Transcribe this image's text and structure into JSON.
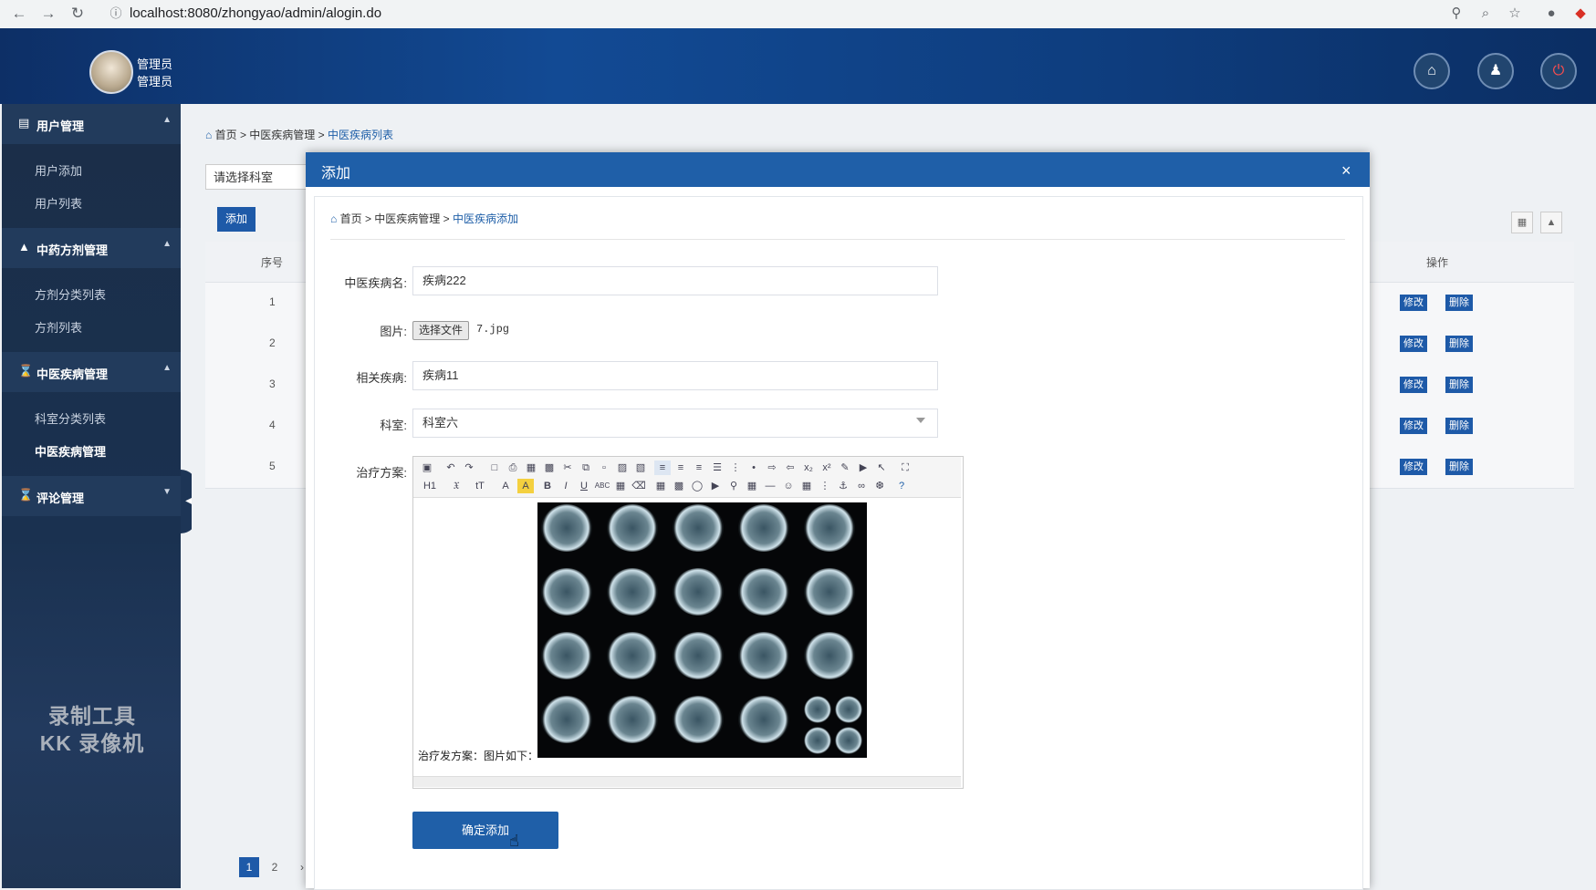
{
  "browser": {
    "url": "localhost:8080/zhongyao/admin/alogin.do",
    "back_icon": "arrow-left",
    "forward_icon": "arrow-right",
    "reload_icon": "reload",
    "info_icon": "info-circle"
  },
  "header": {
    "user_line1": "管理员",
    "user_line2": "管理员"
  },
  "sidebar": {
    "sections": [
      {
        "label": "用户管理",
        "items": [
          "用户添加",
          "用户列表"
        ]
      },
      {
        "label": "中药方剂管理",
        "items": [
          "方剂分类列表",
          "方剂列表"
        ]
      },
      {
        "label": "中医疾病管理",
        "items": [
          "科室分类列表",
          "中医疾病管理"
        ]
      },
      {
        "label": "评论管理",
        "items": []
      }
    ],
    "watermark_line1": "录制工具",
    "watermark_line2": "KK 录像机"
  },
  "background_page": {
    "breadcrumb_home": "首页",
    "breadcrumb_mid": "中医疾病管理",
    "breadcrumb_cur": "中医疾病列表",
    "select_placeholder": "请选择科室",
    "add_button": "添加",
    "col_index": "序号",
    "col_ops": "操作",
    "rows": [
      "1",
      "2",
      "3",
      "4",
      "5"
    ],
    "edit_label": "修改",
    "delete_label": "删除",
    "pages": [
      "1",
      "2"
    ],
    "next": "›"
  },
  "modal": {
    "title": "添加",
    "close": "×",
    "breadcrumb_home": "首页",
    "breadcrumb_mid": "中医疾病管理",
    "breadcrumb_cur": "中医疾病添加",
    "fields": {
      "name_label": "中医疾病名:",
      "name_value": "疾病222",
      "image_label": "图片:",
      "file_button": "选择文件",
      "file_name": "7.jpg",
      "related_label": "相关疾病:",
      "related_value": "疾病11",
      "dept_label": "科室:",
      "dept_value": "科室六",
      "plan_label": "治疗方案:"
    },
    "editor_text": "治疗发方案：图片如下：",
    "submit": "确定添加"
  }
}
